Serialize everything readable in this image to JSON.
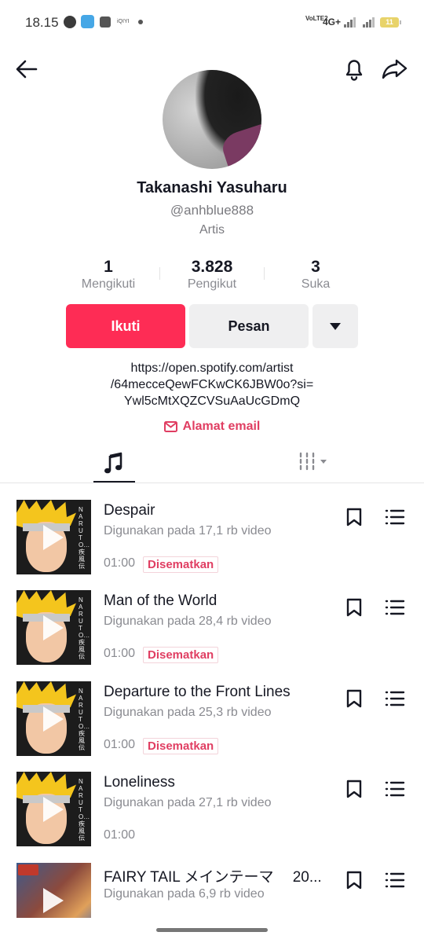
{
  "status_bar": {
    "time": "18.15",
    "iqiyi": "iQIYI",
    "lte": "VoLTE2",
    "network": "4G+",
    "battery": "11"
  },
  "profile": {
    "name": "Takanashi Yasuharu",
    "handle": "@anhblue888",
    "category": "Artis",
    "stats": {
      "following": {
        "value": "1",
        "label": "Mengikuti"
      },
      "followers": {
        "value": "3.828",
        "label": "Pengikut"
      },
      "likes": {
        "value": "3",
        "label": "Suka"
      }
    },
    "follow_label": "Ikuti",
    "message_label": "Pesan",
    "bio_line1": "https://open.spotify.com/artist",
    "bio_line2": "/64mecceQewFCKwCK6JBW0o?si=",
    "bio_line3": "Ywl5cMtXQZCVSuAaUcGDmQ",
    "email_label": "Alamat email"
  },
  "tracks": [
    {
      "title": "Despair",
      "usage": "Digunakan pada 17,1 rb video",
      "duration": "01:00",
      "badge": "Disematkan",
      "thumb_text": "NARUTO…疾風伝"
    },
    {
      "title": "Man of the World",
      "usage": "Digunakan pada 28,4 rb video",
      "duration": "01:00",
      "badge": "Disematkan",
      "thumb_text": "NARUTO…疾風伝"
    },
    {
      "title": "Departure to the Front Lines",
      "usage": "Digunakan pada 25,3 rb video",
      "duration": "01:00",
      "badge": "Disematkan",
      "thumb_text": "NARUTO…疾風伝"
    },
    {
      "title": "Loneliness",
      "usage": "Digunakan pada 27,1 rb video",
      "duration": "01:00",
      "badge": "",
      "thumb_text": "NARUTO…疾風伝"
    },
    {
      "title": "FAIRY TAIL メインテーマ　 20...",
      "usage": "Digunakan pada 6,9 rb video",
      "duration": "",
      "badge": "",
      "thumb_text": ""
    }
  ]
}
